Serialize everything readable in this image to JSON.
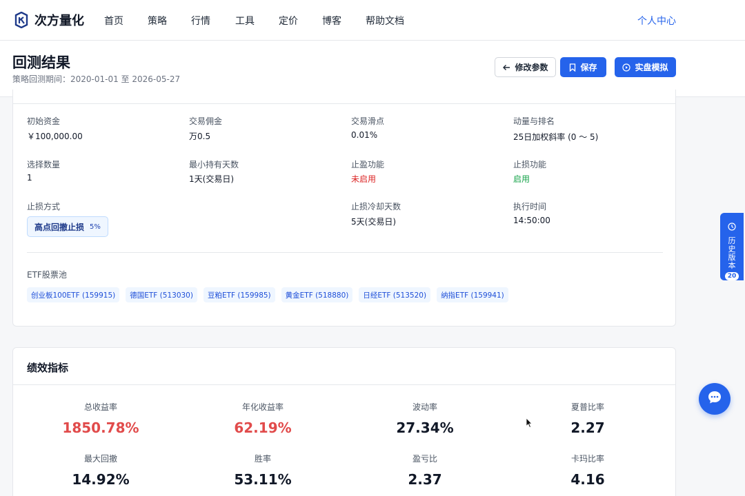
{
  "brand": {
    "name": "次方量化"
  },
  "nav": {
    "items": [
      "首页",
      "策略",
      "行情",
      "工具",
      "定价",
      "博客",
      "帮助文档"
    ],
    "user_center": "个人中心"
  },
  "page": {
    "title": "回测结果",
    "subtitle": "策略回测期间：2020-01-01 至 2026-05-27",
    "buttons": {
      "edit": "修改参数",
      "save": "保存",
      "simulate": "实盘模拟"
    }
  },
  "params": {
    "initial_capital": {
      "label": "初始资金",
      "value": "￥100,000.00"
    },
    "commission": {
      "label": "交易佣金",
      "value": "万0.5"
    },
    "slippage": {
      "label": "交易滑点",
      "value": "0.01%"
    },
    "momentum": {
      "label": "动量与排名",
      "value": "25日加权斜率 (0 ～ 5)"
    },
    "select_count": {
      "label": "选择数量",
      "value": "1"
    },
    "min_hold": {
      "label": "最小持有天数",
      "value": "1天(交易日)"
    },
    "take_profit": {
      "label": "止盈功能",
      "value": "未启用"
    },
    "stop_loss": {
      "label": "止损功能",
      "value": "启用"
    },
    "stop_method": {
      "label": "止损方式",
      "tag": "高点回撤止损",
      "pct": "5%"
    },
    "cooldown": {
      "label": "止损冷却天数",
      "value": "5天(交易日)"
    },
    "exec_time": {
      "label": "执行时间",
      "value": "14:50:00"
    },
    "etf_pool": {
      "label": "ETF股票池",
      "items": [
        "创业板100ETF (159915)",
        "德国ETF (513030)",
        "豆粕ETF (159985)",
        "黄金ETF (518880)",
        "日经ETF (513520)",
        "纳指ETF (159941)"
      ]
    }
  },
  "performance": {
    "title": "绩效指标",
    "metrics": [
      {
        "label": "总收益率",
        "value": "1850.78%"
      },
      {
        "label": "年化收益率",
        "value": "62.19%"
      },
      {
        "label": "波动率",
        "value": "27.34%"
      },
      {
        "label": "夏普比率",
        "value": "2.27"
      },
      {
        "label": "最大回撤",
        "value": "14.92%"
      },
      {
        "label": "胜率",
        "value": "53.11%"
      },
      {
        "label": "盈亏比",
        "value": "2.37"
      },
      {
        "label": "卡玛比率",
        "value": "4.16"
      }
    ]
  },
  "history": {
    "label": "历史版本",
    "count": "20"
  },
  "colors": {
    "accent": "#2563eb",
    "positive_red": "#e14b4b",
    "enabled_green": "#16a34a",
    "disabled_red": "#dc2626"
  },
  "icons": [
    "logo-icon",
    "arrow-left-icon",
    "bookmark-icon",
    "play-circle-icon",
    "clock-icon",
    "chat-icon",
    "cursor-pointer-icon"
  ]
}
